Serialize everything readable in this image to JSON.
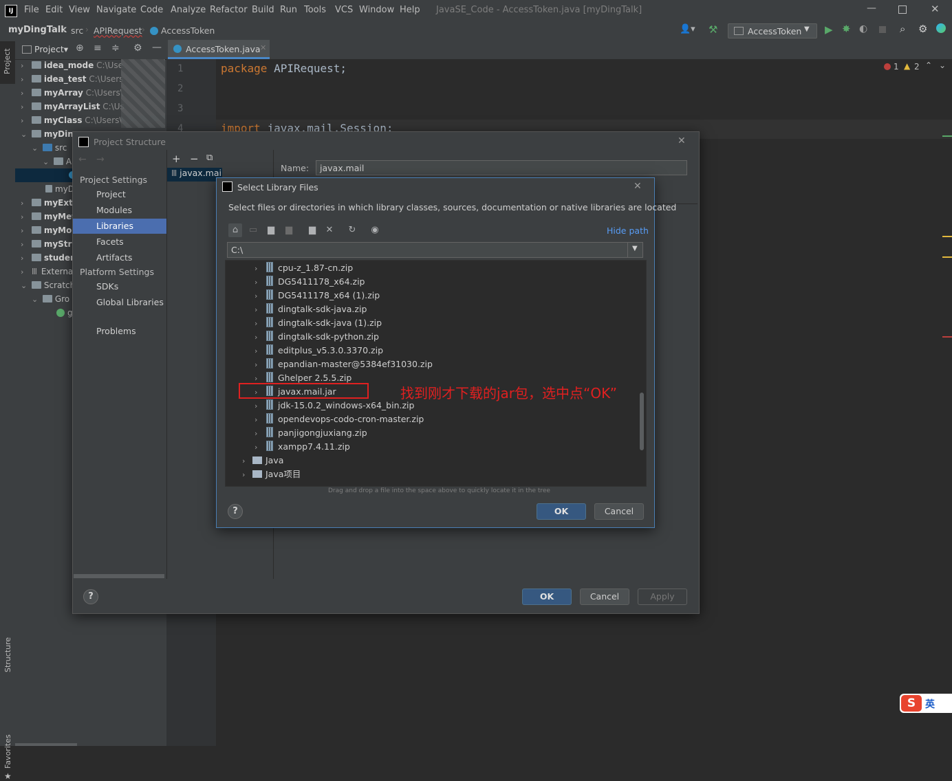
{
  "app": {
    "logo": "IJ",
    "window_title": "JavaSE_Code - AccessToken.java [myDingTalk]"
  },
  "menu": [
    "File",
    "Edit",
    "View",
    "Navigate",
    "Code",
    "Analyze",
    "Refactor",
    "Build",
    "Run",
    "Tools",
    "VCS",
    "Window",
    "Help"
  ],
  "breadcrumb": [
    "myDingTalk",
    "src",
    "APIRequest",
    "AccessToken"
  ],
  "run_config": "AccessToken",
  "project_panel": {
    "title": "Project",
    "tree": [
      {
        "name": "idea_mode",
        "path": "C:\\Use"
      },
      {
        "name": "idea_test",
        "path": "C:\\Users"
      },
      {
        "name": "myArray",
        "path": "C:\\Users\\"
      },
      {
        "name": "myArrayList",
        "path": "C:\\Us"
      },
      {
        "name": "myClass",
        "path": "C:\\Users\\"
      },
      {
        "name": "myDin",
        "path": ""
      },
      {
        "name": "src",
        "path": ""
      },
      {
        "name": "A",
        "path": ""
      },
      {
        "name": "",
        "path": ""
      },
      {
        "name": "myD",
        "path": ""
      },
      {
        "name": "myExt",
        "path": ""
      },
      {
        "name": "myMet",
        "path": ""
      },
      {
        "name": "myMo",
        "path": ""
      },
      {
        "name": "myStri",
        "path": ""
      },
      {
        "name": "studen",
        "path": ""
      },
      {
        "name": "Externa",
        "path": ""
      },
      {
        "name": "Scratch",
        "path": ""
      },
      {
        "name": "Gro",
        "path": ""
      },
      {
        "name": "g",
        "path": ""
      }
    ]
  },
  "side_tabs": {
    "project": "Project",
    "structure": "Structure",
    "favorites": "Favorites"
  },
  "editor": {
    "tab": "AccessToken.java",
    "lines": [
      {
        "no": "1",
        "keyword": "package",
        "text": " APIRequest;"
      },
      {
        "no": "2",
        "keyword": "",
        "text": ""
      },
      {
        "no": "3",
        "keyword": "",
        "text": ""
      },
      {
        "no": "4",
        "keyword": "import",
        "text": " javax.mail.Session;"
      }
    ],
    "error_count": "1",
    "warning_count": "2"
  },
  "project_structure": {
    "title": "Project Structure",
    "project_settings_header": "Project Settings",
    "project_settings": [
      "Project",
      "Modules",
      "Libraries",
      "Facets",
      "Artifacts"
    ],
    "platform_settings_header": "Platform Settings",
    "platform_settings": [
      "SDKs",
      "Global Libraries"
    ],
    "problems": "Problems",
    "selected": "Libraries",
    "library_item": "javax.mail",
    "name_label": "Name:",
    "name_value": "javax.mail",
    "ok": "OK",
    "cancel": "Cancel",
    "apply": "Apply",
    "help": "?"
  },
  "select_library_files": {
    "title": "Select Library Files",
    "description": "Select files or directories in which library classes, sources, documentation or native libraries are located",
    "hide_path": "Hide path",
    "path_value": "C:\\",
    "files": [
      {
        "name": "cpu-z_1.87-cn.zip",
        "type": "zip"
      },
      {
        "name": "DG5411178_x64.zip",
        "type": "zip"
      },
      {
        "name": "DG5411178_x64 (1).zip",
        "type": "zip"
      },
      {
        "name": "dingtalk-sdk-java.zip",
        "type": "zip"
      },
      {
        "name": "dingtalk-sdk-java (1).zip",
        "type": "zip"
      },
      {
        "name": "dingtalk-sdk-python.zip",
        "type": "zip"
      },
      {
        "name": "editplus_v5.3.0.3370.zip",
        "type": "zip"
      },
      {
        "name": "epandian-master@5384ef31030.zip",
        "type": "zip"
      },
      {
        "name": "Ghelper 2.5.5.zip",
        "type": "zip"
      },
      {
        "name": "javax.mail.jar",
        "type": "jar"
      },
      {
        "name": "jdk-15.0.2_windows-x64_bin.zip",
        "type": "zip"
      },
      {
        "name": "opendevops-codo-cron-master.zip",
        "type": "zip"
      },
      {
        "name": "panjigongjuxiang.zip",
        "type": "zip"
      },
      {
        "name": "xampp7.4.11.zip",
        "type": "zip"
      }
    ],
    "folders": [
      "Java",
      "Java项目"
    ],
    "drag_hint": "Drag and drop a file into the space above to quickly locate it in the tree",
    "annotation": "找到刚才下载的jar包，选中点“OK”",
    "ok": "OK",
    "cancel": "Cancel",
    "help": "?"
  },
  "ime": {
    "mode": "英"
  },
  "colors": {
    "accent": "#4a88c7",
    "selection": "#2f65ca",
    "annotation_red": "#e02020",
    "keyword": "#cc7832"
  }
}
